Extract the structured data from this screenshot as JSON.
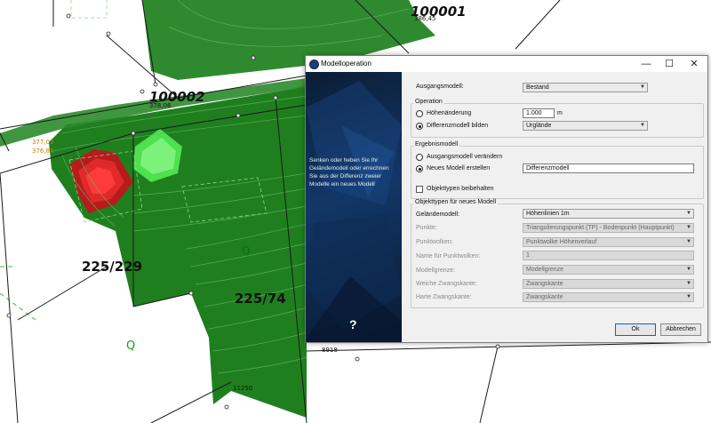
{
  "map": {
    "labels": {
      "parcel_100001": "100001",
      "parcel_100002": "100002",
      "small_386": "386,45",
      "small_378": "378,06",
      "orange_1": "377,03",
      "orange_2": "376,84",
      "parcel_225_229": "225/229",
      "parcel_225_74": "225/74",
      "q_left": "Q",
      "q_dark": "Q",
      "small_8918": "8918",
      "small_11250": "11250"
    }
  },
  "dialog": {
    "title": "Modelloperation",
    "side_text": "Senken oder heben Sie Ihr Geländemodell oder errechnen Sie aus der Differenz zweier Modelle ein neues Modell",
    "help": "?",
    "ausgangsmodell": {
      "label": "Ausgangsmodell:",
      "value": "Bestand"
    },
    "operation": {
      "title": "Operation",
      "option1": "Höhenänderung",
      "option1_value": "1.000",
      "option1_unit": "m",
      "option2": "Differenzmodell bilden",
      "option2_value": "Urglände"
    },
    "ergebnis": {
      "title": "Ergebnismodell",
      "option1": "Ausgangsmodell verändern",
      "option2": "Neues Modell erstellen",
      "option2_value": "Differenzmodell",
      "keep_types": "Objekttypen beibehalten"
    },
    "objekttypen": {
      "title": "Objekttypen für neues Modell",
      "rows": [
        {
          "label": "Geländemodell:",
          "value": "Höhenlinien 1m"
        },
        {
          "label": "Punkte:",
          "value": "Triangulierungspunkt (TP) - Bodenpunkt (Hauptpunkt)"
        },
        {
          "label": "Punktwolken:",
          "value": "Punktwolke Höhenverlauf"
        },
        {
          "label": "Name für Punktwolken:",
          "value": "1"
        },
        {
          "label": "Modellgrenze:",
          "value": "Modellgrenze"
        },
        {
          "label": "Weiche Zwangskante:",
          "value": "Zwangskante"
        },
        {
          "label": "Harte Zwangskante:",
          "value": "Zwangskante"
        }
      ]
    },
    "ok": "Ok",
    "cancel": "Abbrechen"
  }
}
